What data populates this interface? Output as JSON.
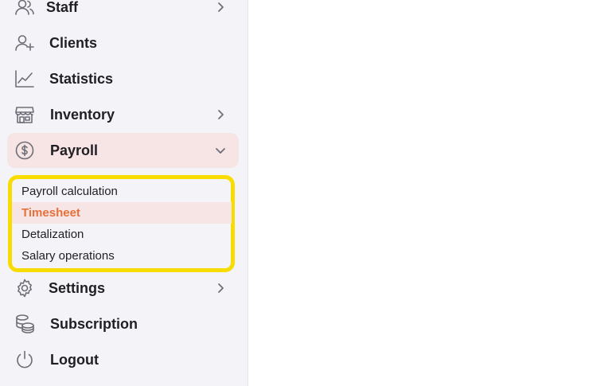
{
  "sidebar": {
    "items": [
      {
        "label": "Staff",
        "icon": "staff-icon",
        "has_chevron": true
      },
      {
        "label": "Clients",
        "icon": "add-user-icon",
        "has_chevron": false
      },
      {
        "label": "Statistics",
        "icon": "line-chart-icon",
        "has_chevron": false
      },
      {
        "label": "Inventory",
        "icon": "store-icon",
        "has_chevron": true
      },
      {
        "label": "Payroll",
        "icon": "dollar-circle-icon",
        "has_chevron": true,
        "expanded": true,
        "active": true
      },
      {
        "label": "Settings",
        "icon": "gear-icon",
        "has_chevron": true
      },
      {
        "label": "Subscription",
        "icon": "coins-icon",
        "has_chevron": false
      },
      {
        "label": "Logout",
        "icon": "power-icon",
        "has_chevron": false
      }
    ],
    "payroll_submenu": [
      {
        "label": "Payroll calculation"
      },
      {
        "label": "Timesheet",
        "active": true
      },
      {
        "label": "Detalization"
      },
      {
        "label": "Salary operations"
      }
    ]
  },
  "colors": {
    "sidebar_bg": "#f4f4f8",
    "active_bg": "#f6e5e4",
    "active_text": "#e8703a",
    "highlight_border": "#f8dc00",
    "text": "#1f1f24",
    "icon": "#6e6e78"
  }
}
